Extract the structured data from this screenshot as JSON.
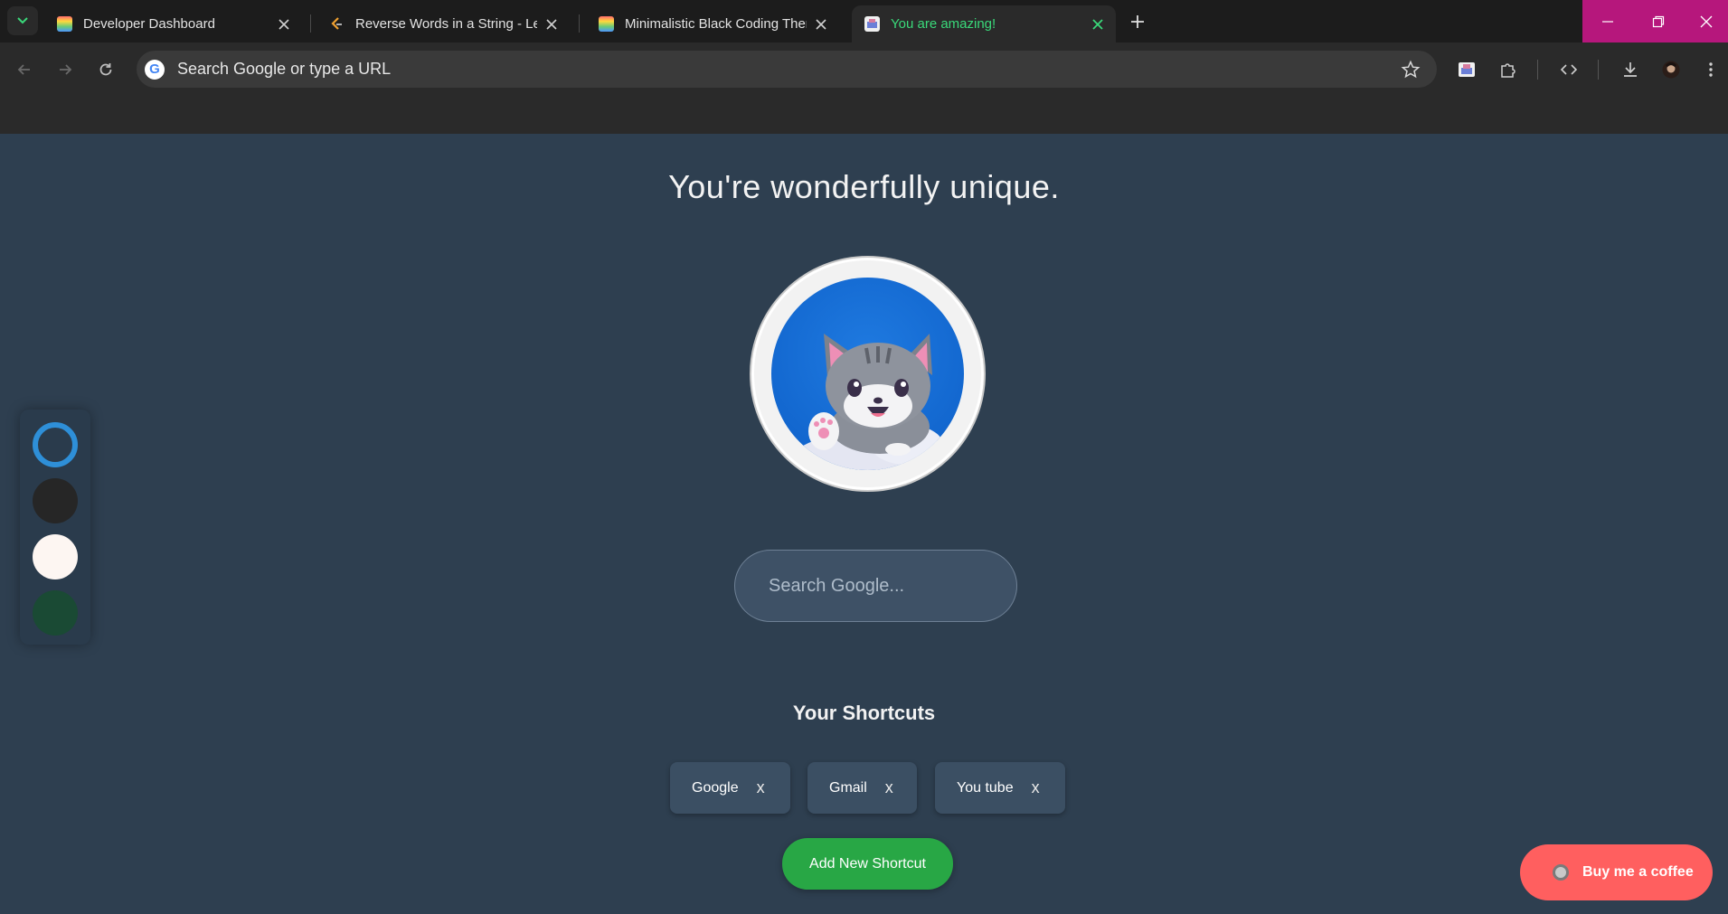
{
  "browser": {
    "tabs": [
      {
        "title": "Developer Dashboard",
        "active": false
      },
      {
        "title": "Reverse Words in a String - LeetCode",
        "active": false
      },
      {
        "title": "Minimalistic Black Coding Theme",
        "active": false
      },
      {
        "title": "You are amazing!",
        "active": true
      }
    ],
    "omnibox_text": "Search Google or type a URL",
    "active_tab_color": "#3ad97a",
    "window_control_color": "#b6177c"
  },
  "page": {
    "greeting": "You're wonderfully unique.",
    "search_placeholder": "Search Google...",
    "theme_swatches": [
      {
        "name": "blue",
        "color": "#2e8fd8",
        "selected": true
      },
      {
        "name": "black",
        "color": "#262626",
        "selected": false
      },
      {
        "name": "white",
        "color": "#fdf6f2",
        "selected": false
      },
      {
        "name": "green",
        "color": "#1a4a34",
        "selected": false
      }
    ],
    "shortcuts_title": "Your Shortcuts",
    "shortcuts": [
      {
        "label": "Google",
        "remove": "x"
      },
      {
        "label": "Gmail",
        "remove": "x"
      },
      {
        "label": "You tube",
        "remove": "x"
      }
    ],
    "add_shortcut_label": "Add New Shortcut",
    "coffee_label": "Buy me a coffee",
    "add_color": "#28a745",
    "coffee_color": "#ff5f5f"
  }
}
